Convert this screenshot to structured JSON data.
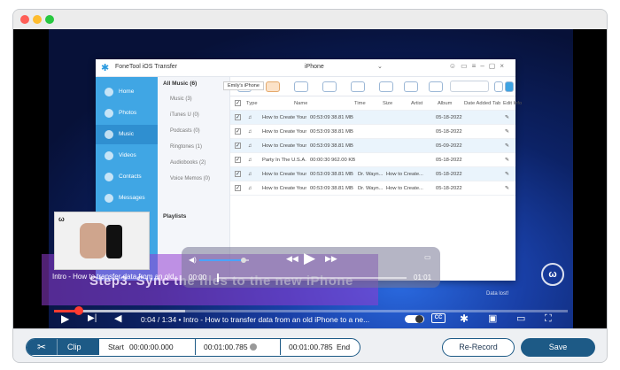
{
  "window": {
    "traffic_colors": [
      "#ff5f57",
      "#febc2e",
      "#28c840"
    ]
  },
  "app": {
    "name": "FoneTool iOS Transfer",
    "device": "iPhone",
    "tooltip": "Emily's iPhone",
    "sidebar": [
      "Home",
      "Photos",
      "Music",
      "Videos",
      "Contacts",
      "Messages"
    ],
    "categories_head": "All Music (6)",
    "categories": [
      "Music (3)",
      "iTunes U (0)",
      "Podcasts (0)",
      "Ringtones (1)",
      "Audiobooks (2)",
      "Voice Memos (0)"
    ],
    "playlists": "Playlists",
    "columns": [
      "Type",
      "Name",
      "Time",
      "Size",
      "Artist",
      "Album",
      "Date Added",
      "Tab",
      "Edit Info"
    ],
    "rows": [
      {
        "name": "How to Create Your Lif...",
        "time": "00:53:09",
        "size": "38.81 MB",
        "artist": "",
        "album": "",
        "date": "05-18-2022"
      },
      {
        "name": "How to Create Your Lif...",
        "time": "00:53:09",
        "size": "38.81 MB",
        "artist": "",
        "album": "",
        "date": "05-18-2022"
      },
      {
        "name": "How to Create Your Lif...",
        "time": "00:53:09",
        "size": "38.81 MB",
        "artist": "",
        "album": "",
        "date": "05-09-2022"
      },
      {
        "name": "Party In The U.S.A.",
        "time": "00:00:30",
        "size": "962.00 KB",
        "artist": "",
        "album": "",
        "date": "05-18-2022"
      },
      {
        "name": "How to Create Your Lif...",
        "time": "00:53:09",
        "size": "38.81 MB",
        "artist": "Dr. Wayn...",
        "album": "How to Create...",
        "date": "05-18-2022"
      },
      {
        "name": "How to Create Your Lif...",
        "time": "00:53:09",
        "size": "38.81 MB",
        "artist": "Dr. Wayn...",
        "album": "How to Create...",
        "date": "05-18-2022"
      }
    ]
  },
  "overlay": {
    "caption": "Step3. Sync the files to the new iPhone",
    "chapter_label": "Intro - How to transfer data from an old",
    "data_lost": "Data lost!",
    "mini_time_start": "00:00",
    "mini_time_end": "01:01"
  },
  "player": {
    "time": "0:04 / 1:34",
    "separator": "•",
    "chapter": "Intro - How to transfer data from an old iPhone to a ne...",
    "cc_label": "CC"
  },
  "clip_bar": {
    "clip_label": "Clip",
    "start_label": "Start",
    "start_value": "00:00:00.000",
    "mid_value": "00:01:00.785",
    "end_value": "00:01:00.785",
    "end_label": "End",
    "rerecord_label": "Re-Record",
    "save_label": "Save"
  },
  "colors": {
    "accent": "#1d5a86",
    "progress": "#ff3b30",
    "sidebar": "#40a6e4"
  },
  "icons": [
    "scissors-icon",
    "play-icon",
    "next-icon",
    "settings-icon",
    "miniplayer-icon",
    "theater-icon",
    "fullscreen-icon",
    "volume-icon",
    "airplay-icon",
    "clock-icon"
  ]
}
